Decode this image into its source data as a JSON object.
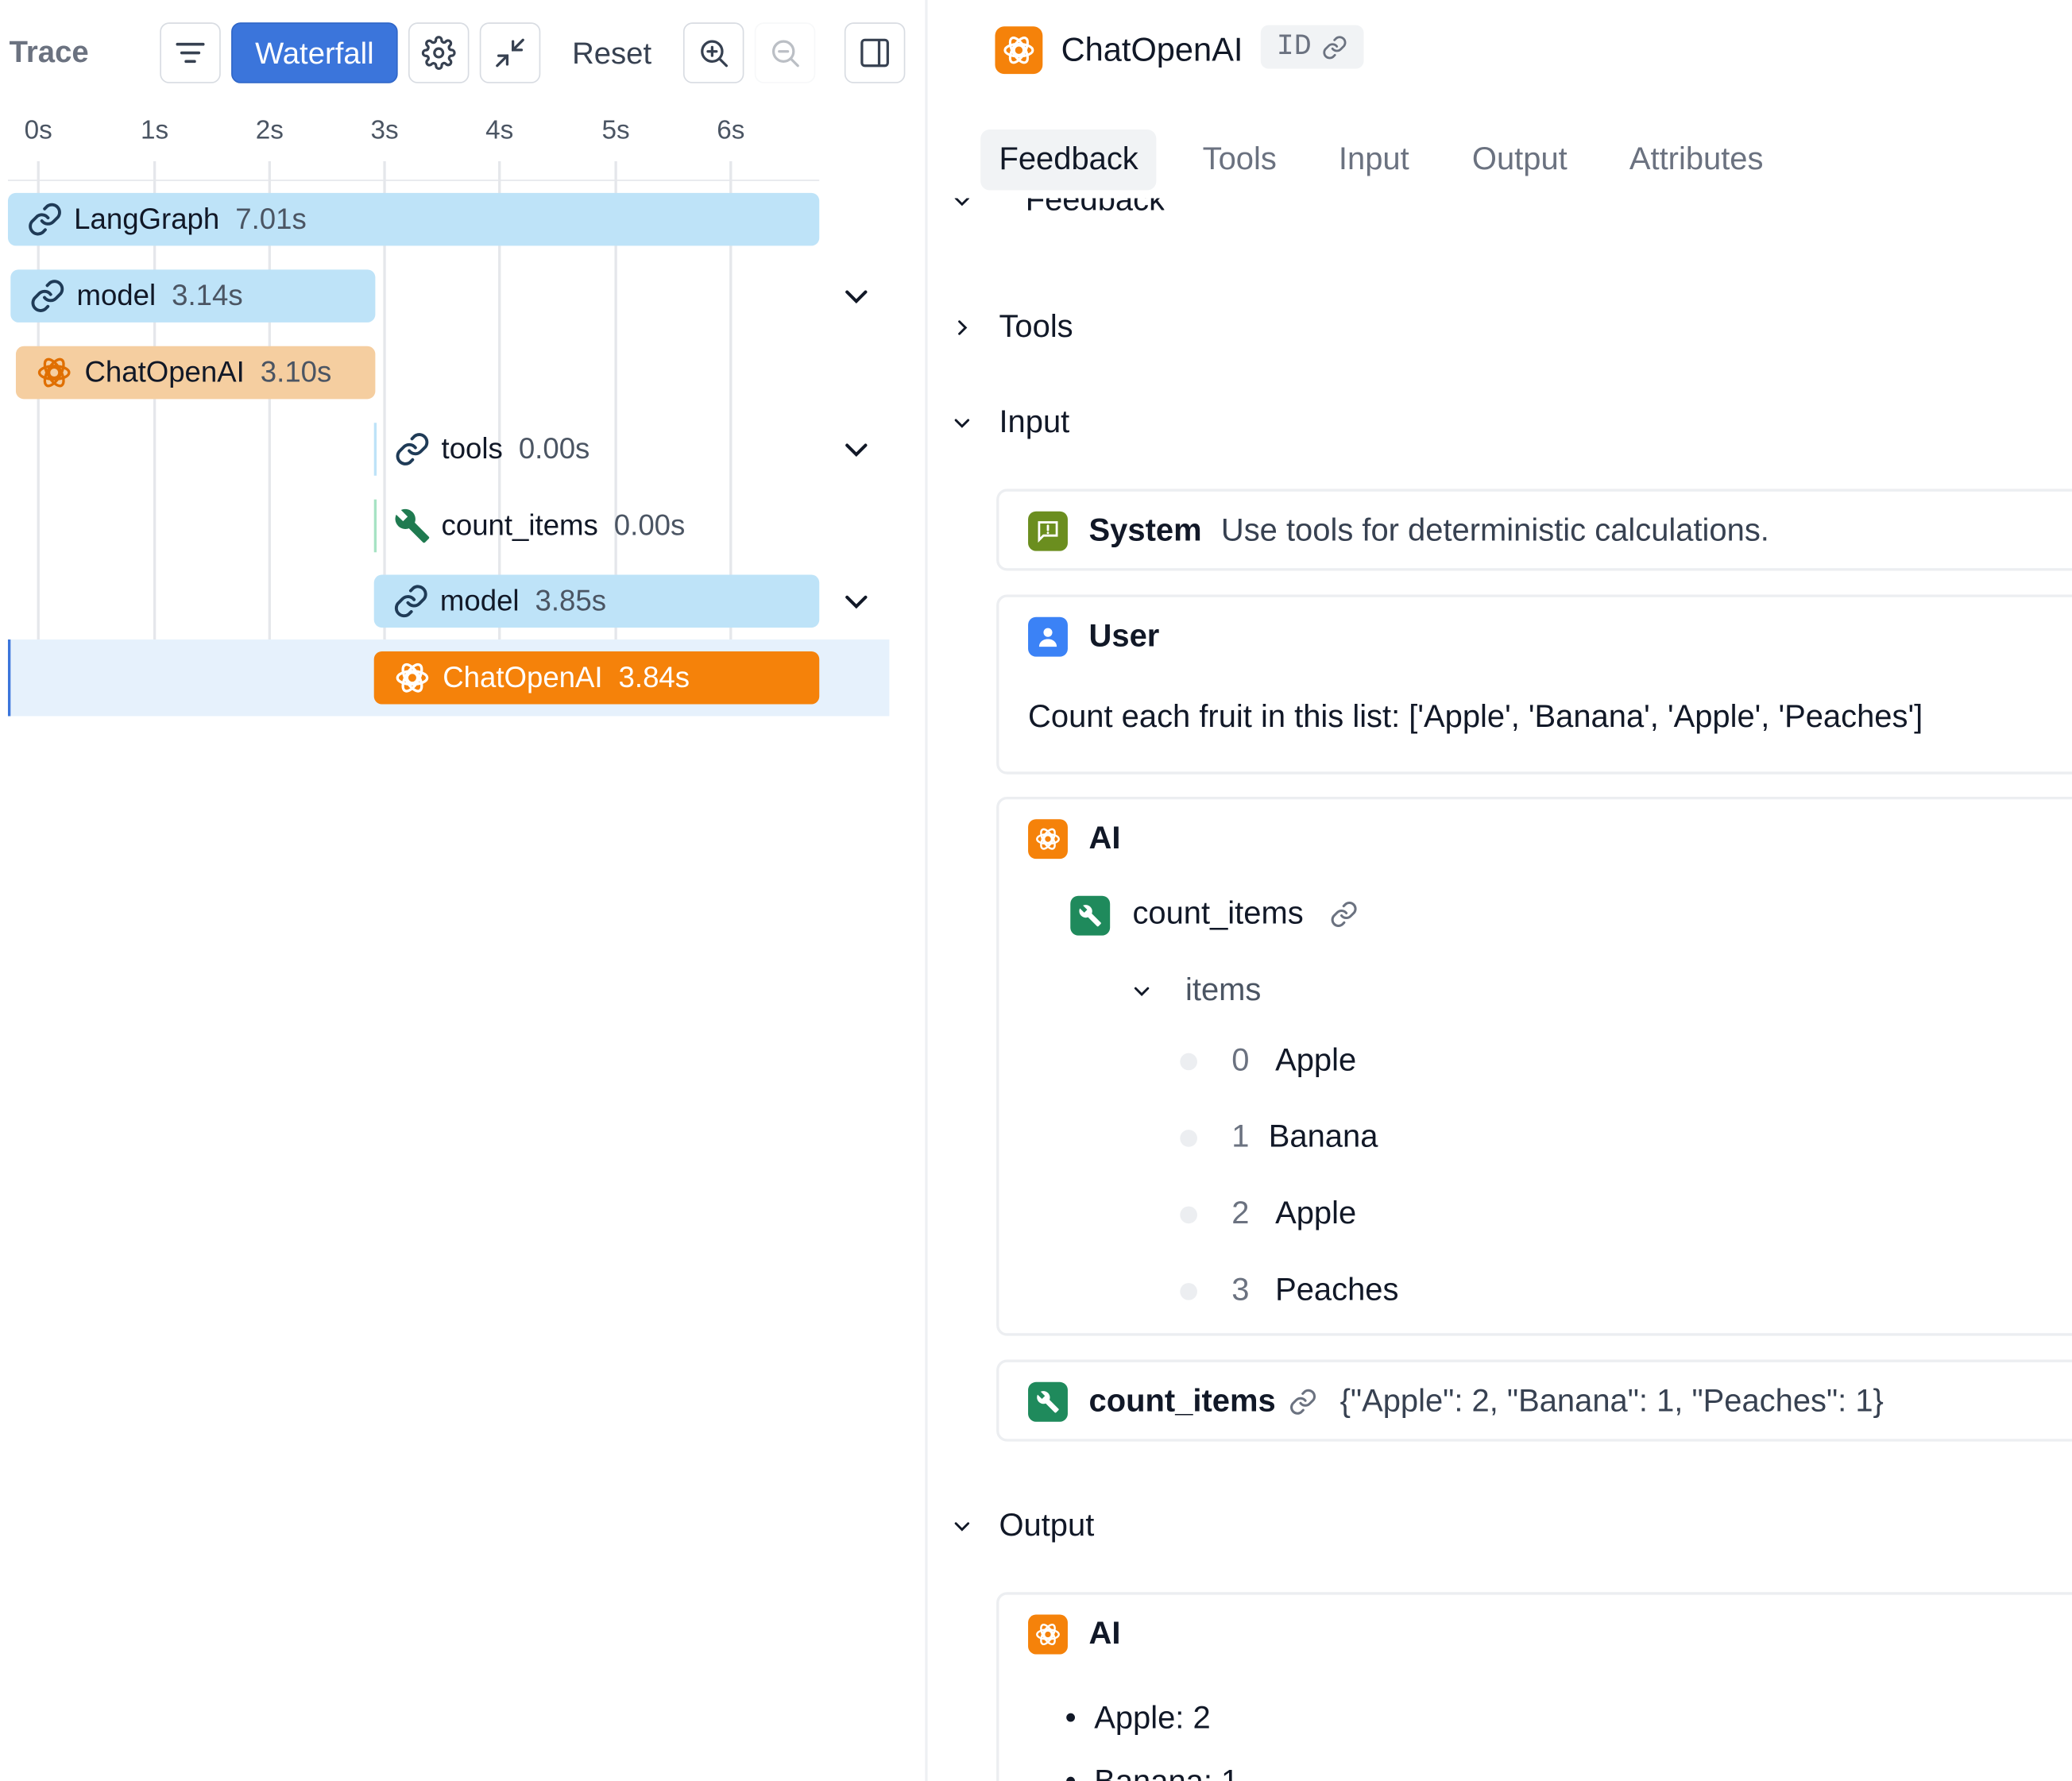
{
  "toolbar": {
    "trace_label": "Trace",
    "waterfall_label": "Waterfall",
    "reset_label": "Reset"
  },
  "timeline": {
    "ticks": [
      "0s",
      "1s",
      "2s",
      "3s",
      "4s",
      "5s",
      "6s"
    ]
  },
  "runs": [
    {
      "name": "LangGraph",
      "duration": "7.01s",
      "icon": "chain-link-icon",
      "color": "#bee3f8"
    },
    {
      "name": "model",
      "duration": "3.14s",
      "icon": "chain-link-icon",
      "color": "#bee3f8"
    },
    {
      "name": "ChatOpenAI",
      "duration": "3.10s",
      "icon": "openai-icon",
      "color": "#f5cea0"
    },
    {
      "name": "tools",
      "duration": "0.00s",
      "icon": "chain-link-icon"
    },
    {
      "name": "count_items",
      "duration": "0.00s",
      "icon": "wrench-icon"
    },
    {
      "name": "model",
      "duration": "3.85s",
      "icon": "chain-link-icon",
      "color": "#bee3f8"
    },
    {
      "name": "ChatOpenAI",
      "duration": "3.84s",
      "icon": "openai-icon",
      "color": "#f5820a"
    }
  ],
  "detail": {
    "title": "ChatOpenAI",
    "id_label": "ID",
    "tabs": [
      "Feedback",
      "Tools",
      "Input",
      "Output",
      "Attributes"
    ],
    "active_tab": "Feedback",
    "sections": {
      "feedback": "Feedback",
      "tools": "Tools",
      "input": "Input",
      "output": "Output"
    },
    "input": {
      "system": {
        "role": "System",
        "text": "Use tools for deterministic calculations."
      },
      "user": {
        "role": "User",
        "text": "Count each fruit in this list: ['Apple', 'Banana', 'Apple', 'Peaches']"
      },
      "ai": {
        "role": "AI",
        "tool_call": "count_items",
        "arg_name": "items",
        "items": [
          {
            "index": "0",
            "value": "Apple"
          },
          {
            "index": "1",
            "value": "Banana"
          },
          {
            "index": "2",
            "value": "Apple"
          },
          {
            "index": "3",
            "value": "Peaches"
          }
        ]
      },
      "tool_result": {
        "name": "count_items",
        "result": "{\"Apple\": 2, \"Banana\": 1, \"Peaches\": 1}"
      }
    },
    "output": {
      "role": "AI",
      "bullets": [
        "Apple: 2",
        "Banana: 1"
      ]
    }
  },
  "colors": {
    "accent": "#3b75db",
    "openai_orange": "#f5820a",
    "chain_bar": "#bee3f8",
    "tool_green": "#1f8a5c",
    "system_green": "#6b8e1f",
    "user_blue": "#3b82f6"
  }
}
